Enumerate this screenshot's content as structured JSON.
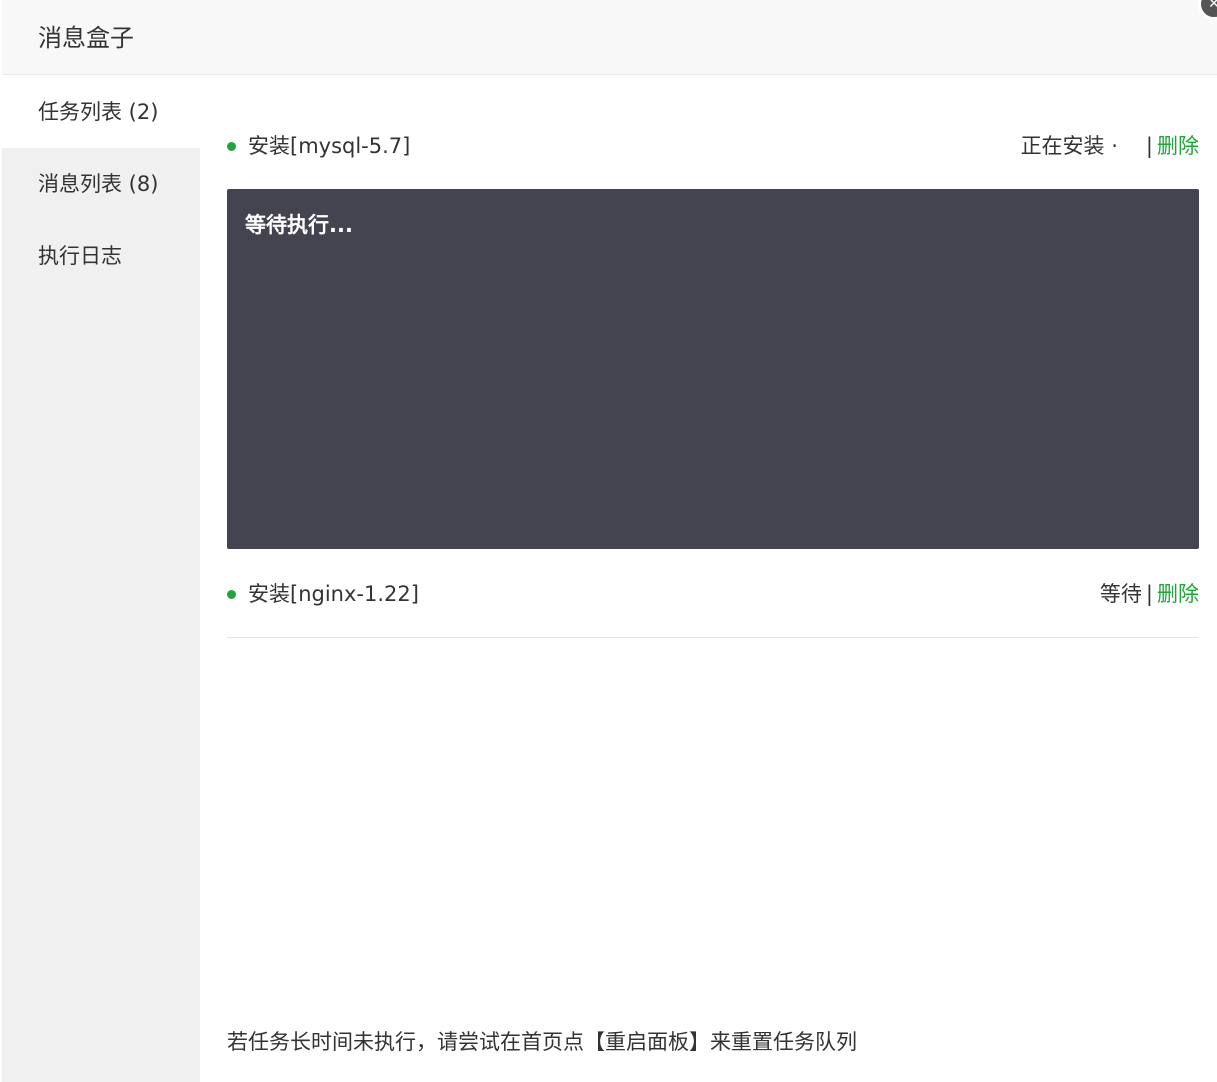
{
  "dialog": {
    "title": "消息盒子",
    "close_icon": "close-icon"
  },
  "sidebar": {
    "items": [
      {
        "label": "任务列表 (2)",
        "active": true
      },
      {
        "label": "消息列表 (8)",
        "active": false
      },
      {
        "label": "执行日志",
        "active": false
      }
    ]
  },
  "tasks": [
    {
      "name": "安装[mysql-5.7]",
      "status": "正在安装 ·",
      "separator": "|",
      "delete_label": "删除",
      "console_text": "等待执行..."
    },
    {
      "name": "安装[nginx-1.22]",
      "status": "等待",
      "separator": "|",
      "delete_label": "删除"
    }
  ],
  "footer": {
    "tip": "若任务长时间未执行，请尝试在首页点【重启面板】来重置任务队列"
  },
  "colors": {
    "accent_green": "#20a53a",
    "console_bg": "#444350",
    "sidebar_bg": "#f0f0f0"
  }
}
